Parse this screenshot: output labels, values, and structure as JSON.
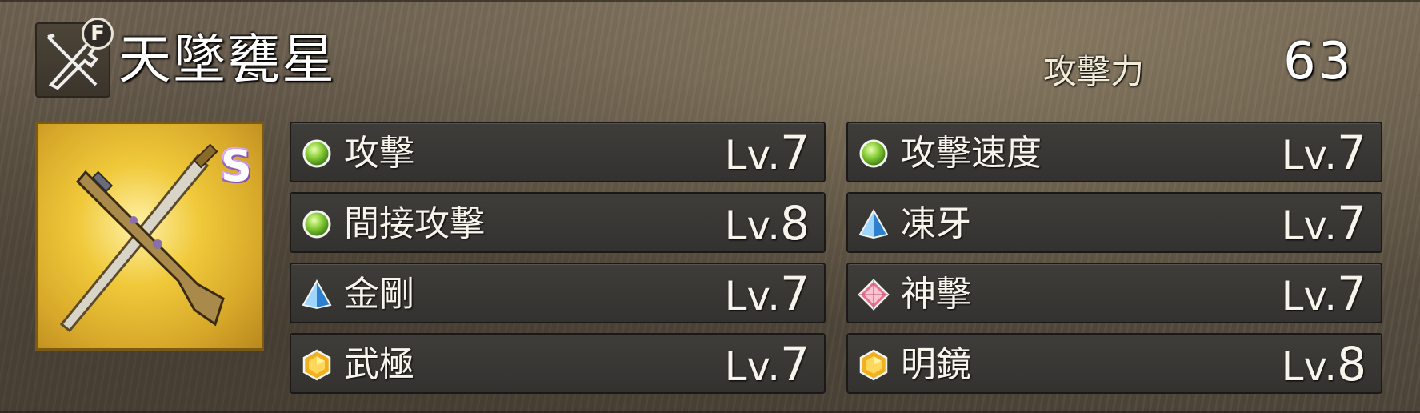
{
  "weapon": {
    "name": "天墜甕星",
    "type_icon": "gun-blade-icon",
    "f_badge": "F",
    "rarity": "S",
    "attack_label": "攻擊力",
    "attack_value": "63"
  },
  "colors": {
    "green": "#7ec43a",
    "blue": "#4a9fe6",
    "pink": "#e8708a",
    "gold": "#f0b020"
  },
  "skills": [
    {
      "name": "攻擊",
      "lv_prefix": "Lv.",
      "lv": "7",
      "gem": "green-orb-icon"
    },
    {
      "name": "攻擊速度",
      "lv_prefix": "Lv.",
      "lv": "7",
      "gem": "green-orb-icon"
    },
    {
      "name": "間接攻擊",
      "lv_prefix": "Lv.",
      "lv": "8",
      "gem": "green-orb-icon"
    },
    {
      "name": "凍牙",
      "lv_prefix": "Lv.",
      "lv": "7",
      "gem": "blue-pyramid-icon"
    },
    {
      "name": "金剛",
      "lv_prefix": "Lv.",
      "lv": "7",
      "gem": "blue-pyramid-icon"
    },
    {
      "name": "神擊",
      "lv_prefix": "Lv.",
      "lv": "7",
      "gem": "pink-diamond-icon"
    },
    {
      "name": "武極",
      "lv_prefix": "Lv.",
      "lv": "7",
      "gem": "gold-hexagon-icon"
    },
    {
      "name": "明鏡",
      "lv_prefix": "Lv.",
      "lv": "8",
      "gem": "gold-hexagon-icon"
    }
  ]
}
